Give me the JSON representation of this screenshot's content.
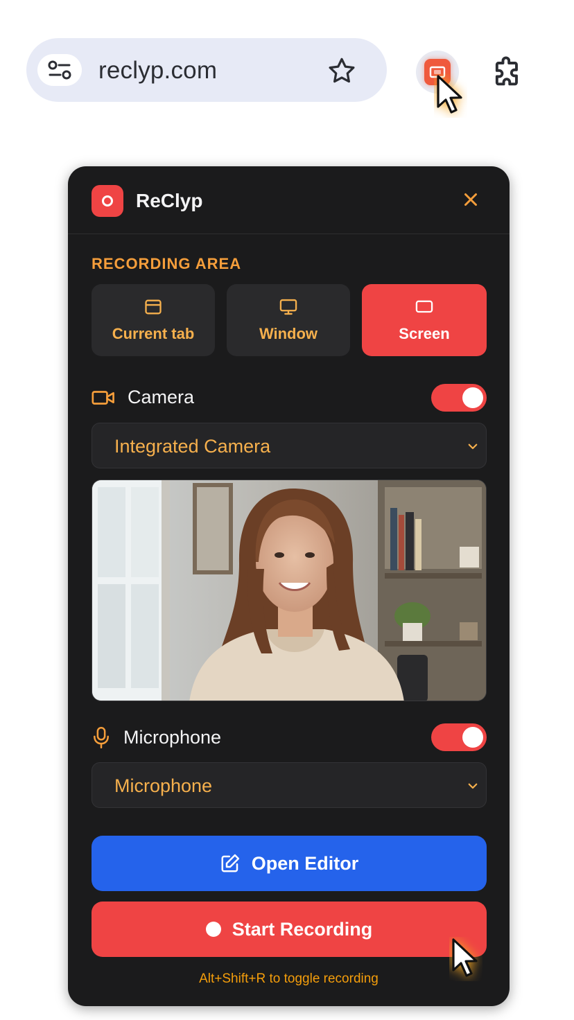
{
  "browser": {
    "url": "reclyp.com"
  },
  "popup": {
    "brand": "ReClyp",
    "recording_area": {
      "label": "RECORDING AREA",
      "options": [
        {
          "label": "Current tab",
          "icon": "browser-tab-icon",
          "active": false
        },
        {
          "label": "Window",
          "icon": "monitor-icon",
          "active": false
        },
        {
          "label": "Screen",
          "icon": "screen-icon",
          "active": true
        }
      ]
    },
    "camera": {
      "label": "Camera",
      "enabled": true,
      "device": "Integrated Camera"
    },
    "microphone": {
      "label": "Microphone",
      "enabled": true,
      "device": "Microphone"
    },
    "open_editor_label": "Open Editor",
    "start_recording_label": "Start Recording",
    "shortcut_hint": "Alt+Shift+R to toggle recording"
  },
  "colors": {
    "accent_red": "#ef4444",
    "accent_orange": "#f6b04d",
    "accent_blue": "#2563eb",
    "panel_bg": "#1b1b1c"
  }
}
